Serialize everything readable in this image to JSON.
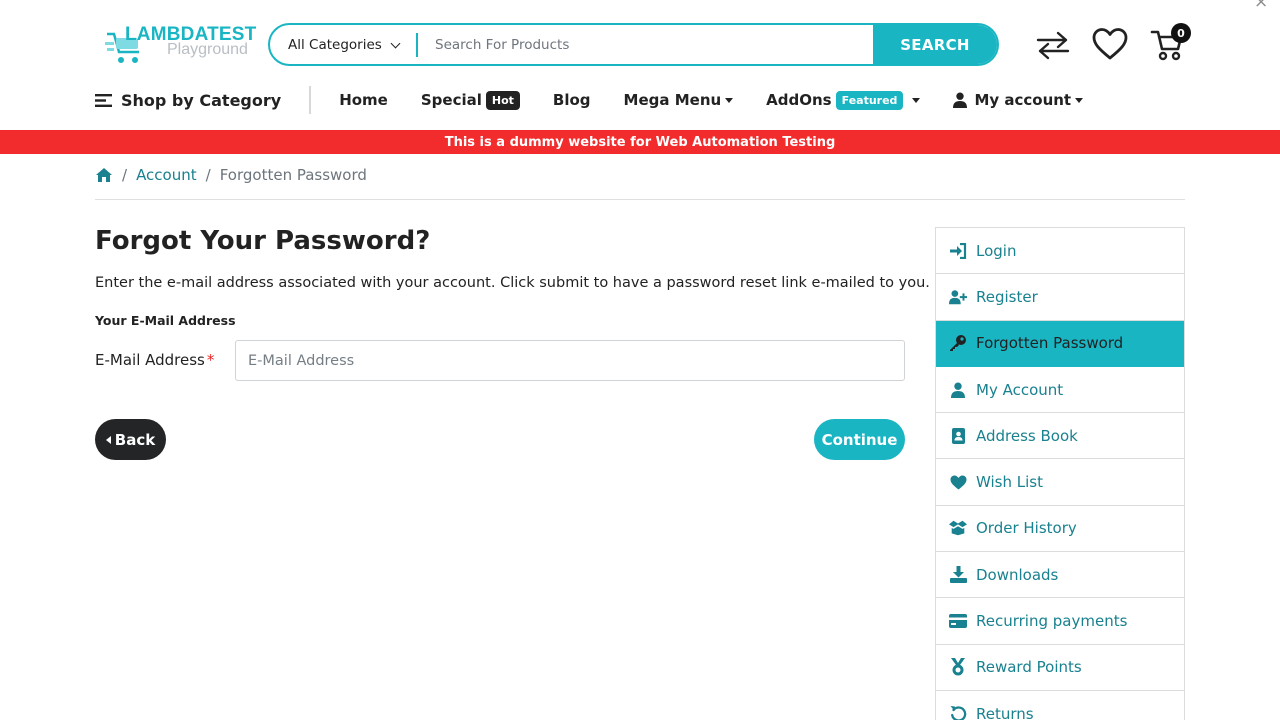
{
  "header": {
    "logo_brand": "LAMBDATEST",
    "logo_sub": "Playground",
    "category_select": "All Categories",
    "search_placeholder": "Search For Products",
    "search_button": "SEARCH",
    "cart_count": "0"
  },
  "nav": {
    "shop_by_category": "Shop by Category",
    "items": [
      {
        "label": "Home"
      },
      {
        "label": "Special",
        "tag": "Hot"
      },
      {
        "label": "Blog"
      },
      {
        "label": "Mega Menu"
      },
      {
        "label": "AddOns",
        "tag": "Featured"
      },
      {
        "label": "My account"
      }
    ]
  },
  "banner": "This is a dummy website for Web Automation Testing",
  "breadcrumb": {
    "account": "Account",
    "current": "Forgotten Password"
  },
  "main": {
    "title": "Forgot Your Password?",
    "description": "Enter the e-mail address associated with your account. Click submit to have a password reset link e-mailed to you.",
    "legend": "Your E-Mail Address",
    "email_label": "E-Mail Address",
    "email_placeholder": "E-Mail Address",
    "back_button": "Back",
    "continue_button": "Continue"
  },
  "sidebar": {
    "items": [
      {
        "label": "Login",
        "icon": "sign-in-icon"
      },
      {
        "label": "Register",
        "icon": "user-plus-icon"
      },
      {
        "label": "Forgotten Password",
        "icon": "key-icon",
        "active": true
      },
      {
        "label": "My Account",
        "icon": "user-icon"
      },
      {
        "label": "Address Book",
        "icon": "address-book-icon"
      },
      {
        "label": "Wish List",
        "icon": "heart-icon"
      },
      {
        "label": "Order History",
        "icon": "box-open-icon"
      },
      {
        "label": "Downloads",
        "icon": "download-icon"
      },
      {
        "label": "Recurring payments",
        "icon": "credit-card-icon"
      },
      {
        "label": "Reward Points",
        "icon": "medal-icon"
      },
      {
        "label": "Returns",
        "icon": "undo-icon"
      }
    ]
  },
  "colors": {
    "accent": "#19b5c3",
    "link": "#19818f",
    "banner": "#f22c2c",
    "dark_button": "#232526"
  }
}
